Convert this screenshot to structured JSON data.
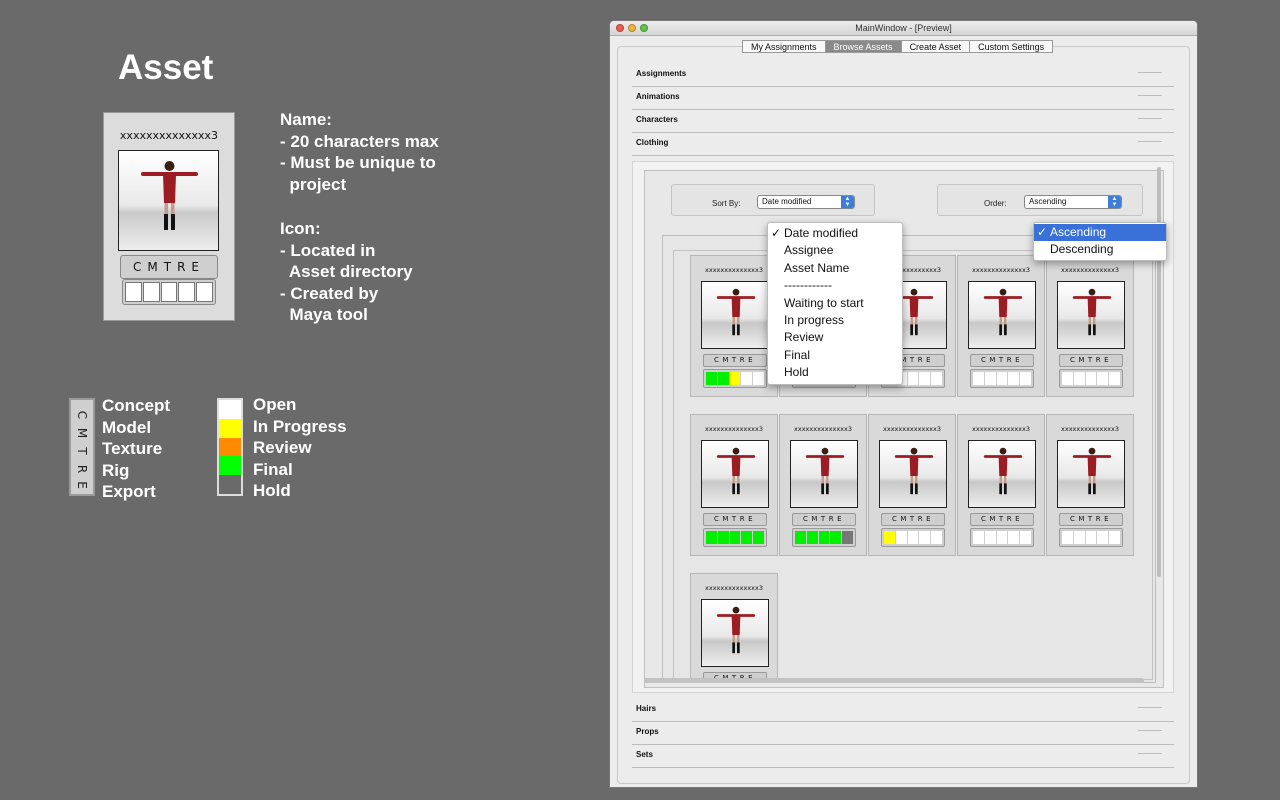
{
  "annotation": {
    "title": "Asset",
    "card": {
      "code": "xxxxxxxxxxxxxx3",
      "status_letters": "CMTRE"
    },
    "name_notes": [
      "Name:",
      "- 20 characters max",
      "- Must be unique to",
      "  project"
    ],
    "icon_notes": [
      "Icon:",
      "- Located in",
      "  Asset directory",
      "- Created by",
      "  Maya tool"
    ],
    "stage_letters": [
      "C",
      "M",
      "T",
      "R",
      "E"
    ],
    "stage_labels": [
      "Concept",
      "Model",
      "Texture",
      "Rig",
      "Export"
    ],
    "status_colors": [
      "#ffffff",
      "#ffff00",
      "#ff8c00",
      "#00ff00",
      "#6a6a6a"
    ],
    "status_labels": [
      "Open",
      "In Progress",
      "Review",
      "Final",
      "Hold"
    ]
  },
  "window": {
    "title": "MainWindow - [Preview]",
    "tabs": [
      "My Assignments",
      "Browse Assets",
      "Create Asset",
      "Custom Settings"
    ],
    "active_tab": "Browse Assets",
    "sections_top": [
      "Assignments",
      "Animations",
      "Characters",
      "Clothing"
    ],
    "sections_bottom": [
      "Hairs",
      "Props",
      "Sets"
    ],
    "sort": {
      "label": "Sort By:",
      "value": "Date modified",
      "options": [
        "Date modified",
        "Assignee",
        "Asset Name",
        "------------",
        "Waiting to start",
        "In progress",
        "Review",
        "Final",
        "Hold"
      ]
    },
    "order": {
      "label": "Order:",
      "value": "Ascending",
      "options": [
        "Ascending",
        "Descending"
      ]
    },
    "assets": [
      {
        "code": "xxxxxxxxxxxxxx3",
        "status": "CMTRE",
        "bars": [
          "#00ee00",
          "#00ee00",
          "#ffff00",
          "#ffffff",
          "#ffffff"
        ]
      },
      {
        "code": "xxxxxxxxxxxxxx3",
        "status": "CMTRE",
        "bars": [
          "#ffff00",
          "#ffffff",
          "#ffffff",
          "#ffffff",
          "#ffffff"
        ]
      },
      {
        "code": "xxxxxxxxxxxxxx3",
        "status": "CMTRE",
        "bars": [
          "#ffffff",
          "#ffffff",
          "#ffffff",
          "#ffffff",
          "#ffffff"
        ]
      },
      {
        "code": "xxxxxxxxxxxxxx3",
        "status": "CMTRE",
        "bars": [
          "#ffffff",
          "#ffffff",
          "#ffffff",
          "#ffffff",
          "#ffffff"
        ]
      },
      {
        "code": "xxxxxxxxxxxxxx3",
        "status": "CMTRE",
        "bars": [
          "#ffffff",
          "#ffffff",
          "#ffffff",
          "#ffffff",
          "#ffffff"
        ]
      },
      {
        "code": "xxxxxxxxxxxxxx3",
        "status": "CMTRE",
        "bars": [
          "#00ee00",
          "#00ee00",
          "#00ee00",
          "#00ee00",
          "#00ee00"
        ]
      },
      {
        "code": "xxxxxxxxxxxxxx3",
        "status": "CMTRE",
        "bars": [
          "#00ee00",
          "#00ee00",
          "#00ee00",
          "#00ee00",
          "#777777"
        ]
      },
      {
        "code": "xxxxxxxxxxxxxx3",
        "status": "CMTRE",
        "bars": [
          "#ffff00",
          "#ffffff",
          "#ffffff",
          "#ffffff",
          "#ffffff"
        ]
      },
      {
        "code": "xxxxxxxxxxxxxx3",
        "status": "CMTRE",
        "bars": [
          "#ffffff",
          "#ffffff",
          "#ffffff",
          "#ffffff",
          "#ffffff"
        ]
      },
      {
        "code": "xxxxxxxxxxxxxx3",
        "status": "CMTRE",
        "bars": [
          "#ffffff",
          "#ffffff",
          "#ffffff",
          "#ffffff",
          "#ffffff"
        ]
      },
      {
        "code": "xxxxxxxxxxxxxx3",
        "status": "CMTRE",
        "bars": [
          "#ffffff",
          "#ffffff",
          "#ffffff",
          "#ffffff",
          "#ffffff"
        ]
      }
    ]
  }
}
